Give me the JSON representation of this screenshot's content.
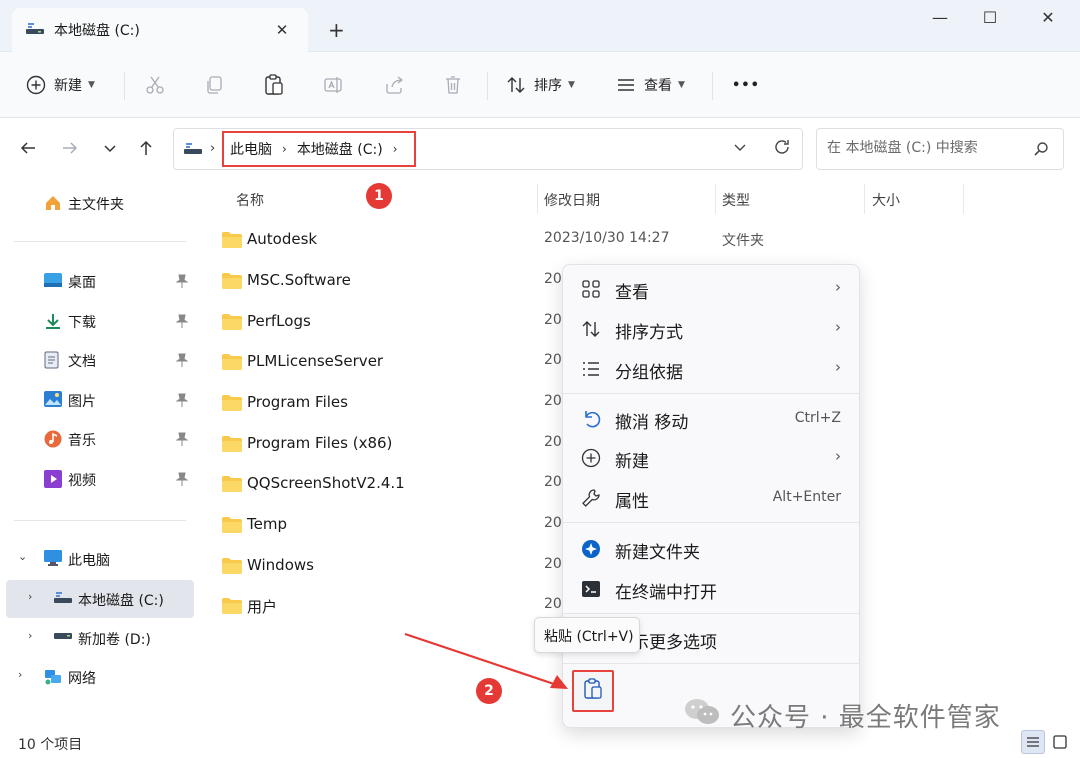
{
  "window": {
    "tab_title": "本地磁盘 (C:)",
    "tab_close": "✕",
    "new_tab": "+",
    "minimize": "—",
    "maximize": "☐",
    "close": "✕"
  },
  "toolbar": {
    "new_label": "新建",
    "sort_label": "排序",
    "view_label": "查看",
    "more_label": "•••"
  },
  "address": {
    "breadcrumb": [
      "此电脑",
      "本地磁盘 (C:)"
    ],
    "search_placeholder": "在 本地磁盘 (C:) 中搜索"
  },
  "nav": {
    "home": "主文件夹",
    "quick_access": [
      {
        "label": "桌面",
        "icon": "desktop-icon"
      },
      {
        "label": "下载",
        "icon": "download-icon"
      },
      {
        "label": "文档",
        "icon": "documents-icon"
      },
      {
        "label": "图片",
        "icon": "pictures-icon"
      },
      {
        "label": "音乐",
        "icon": "music-icon"
      },
      {
        "label": "视频",
        "icon": "videos-icon"
      }
    ],
    "this_pc": "此电脑",
    "drive_c": "本地磁盘 (C:)",
    "drive_d": "新加卷 (D:)",
    "network": "网络"
  },
  "columns": {
    "name": "名称",
    "date": "修改日期",
    "type": "类型",
    "size": "大小"
  },
  "files": [
    {
      "name": "Autodesk",
      "date": "2023/10/30 14:27",
      "type": "文件夹"
    },
    {
      "name": "MSC.Software",
      "date": "20"
    },
    {
      "name": "PerfLogs",
      "date": "20"
    },
    {
      "name": "PLMLicenseServer",
      "date": "20"
    },
    {
      "name": "Program Files",
      "date": "20"
    },
    {
      "name": "Program Files (x86)",
      "date": "20"
    },
    {
      "name": "QQScreenShotV2.4.1",
      "date": "20"
    },
    {
      "name": "Temp",
      "date": "20"
    },
    {
      "name": "Windows",
      "date": "20"
    },
    {
      "name": "用户",
      "date": "20"
    }
  ],
  "context_menu": {
    "view": "查看",
    "sort": "排序方式",
    "group": "分组依据",
    "undo": "撤消 移动",
    "undo_shortcut": "Ctrl+Z",
    "new": "新建",
    "properties": "属性",
    "properties_shortcut": "Alt+Enter",
    "new_folder": "新建文件夹",
    "open_terminal": "在终端中打开",
    "more_options": "显示更多选项"
  },
  "tooltip": {
    "paste": "粘贴 (Ctrl+V)"
  },
  "annotations": {
    "badge1": "1",
    "badge2": "2"
  },
  "status": {
    "item_count": "10 个项目"
  },
  "watermark": {
    "text": "公众号 · 最全软件管家"
  },
  "colors": {
    "annotation_red": "#e8423c",
    "folder_yellow": "#f8c94a",
    "accent_blue": "#0a64c8"
  }
}
